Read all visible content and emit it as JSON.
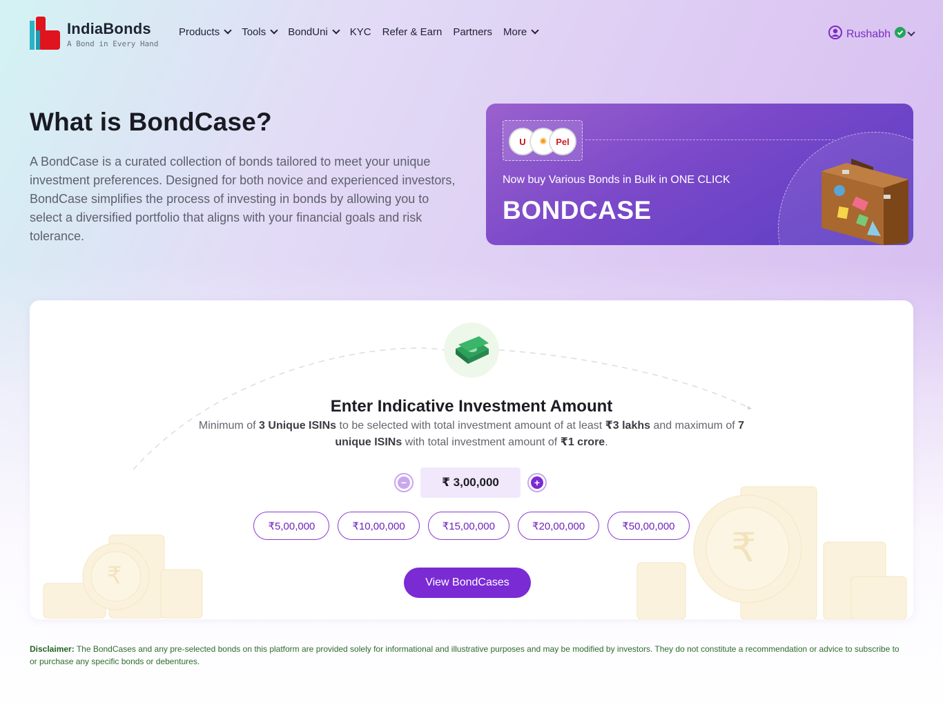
{
  "brand": {
    "name": "IndiaBonds",
    "tagline": "A Bond in Every Hand"
  },
  "nav": {
    "items": [
      {
        "label": "Products",
        "dropdown": true
      },
      {
        "label": "Tools",
        "dropdown": true
      },
      {
        "label": "BondUni",
        "dropdown": true
      },
      {
        "label": "KYC",
        "dropdown": false
      },
      {
        "label": "Refer & Earn",
        "dropdown": false
      },
      {
        "label": "Partners",
        "dropdown": false
      },
      {
        "label": "More",
        "dropdown": true
      }
    ],
    "user": {
      "name": "Rushabh",
      "verified": true
    }
  },
  "hero": {
    "title": "What is BondCase?",
    "description": "A BondCase is a curated collection of bonds tailored to meet your unique investment preferences. Designed for both novice and experienced investors, BondCase simplifies the process of investing in bonds by allowing you to select a diversified portfolio that aligns with your financial goals and risk tolerance."
  },
  "banner": {
    "subtitle": "Now buy Various Bonds in Bulk in ONE CLICK",
    "title": "BONDCASE"
  },
  "investment": {
    "title": "Enter Indicative Investment Amount",
    "desc": {
      "p1": "Minimum of ",
      "b1": "3 Unique ISINs",
      "p2": " to be selected with total investment amount of at least ",
      "b2": "₹3 lakhs",
      "p3": " and maximum of ",
      "b3": "7 unique ISINs",
      "p4": " with total investment amount of ",
      "b4": "₹1 crore",
      "p5": "."
    },
    "amount": "₹ 3,00,000",
    "presets": [
      "₹5,00,000",
      "₹10,00,000",
      "₹15,00,000",
      "₹20,00,000",
      "₹50,00,000"
    ],
    "cta": "View BondCases"
  },
  "disclaimer": {
    "label": "Disclaimer:",
    "text": " The BondCases and any pre-selected bonds on this platform are provided solely for informational and illustrative purposes and may be modified by investors. They do not constitute a recommendation or advice to subscribe to or purchase any specific bonds or debentures."
  },
  "colors": {
    "accent": "#7a2bd4",
    "verified": "#22a55a",
    "disclaimer": "#2e6b2d"
  }
}
